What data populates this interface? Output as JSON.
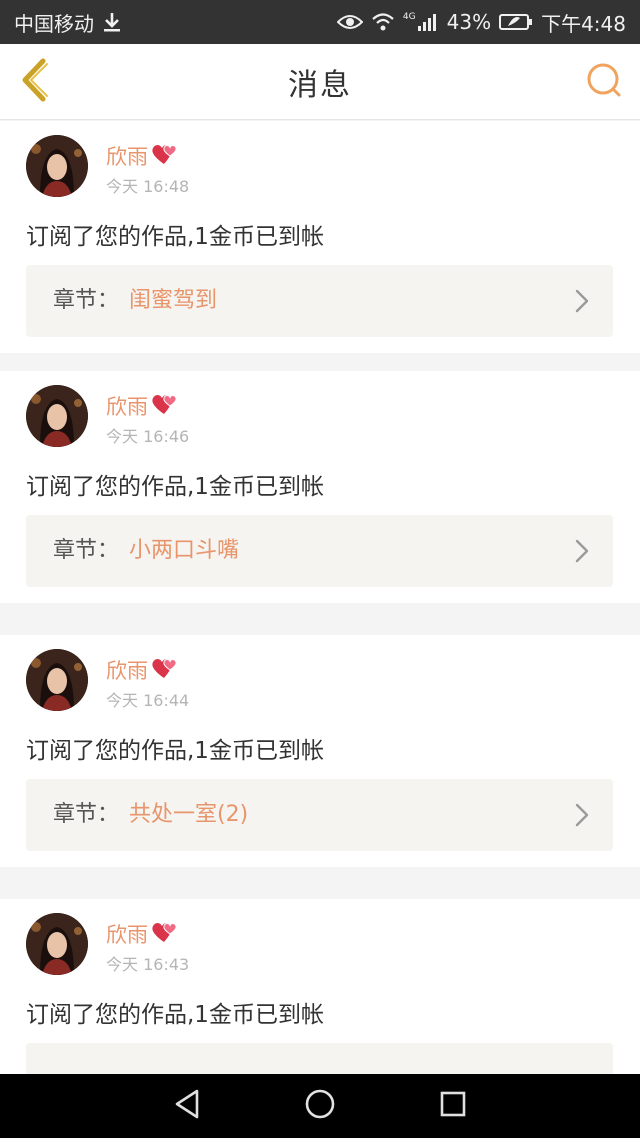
{
  "status_bar": {
    "carrier": "中国移动",
    "network": "4G",
    "battery": "43%",
    "time": "下午4:48",
    "icons": [
      "download-icon",
      "eye-icon",
      "wifi-icon",
      "signal-icon",
      "battery-icon"
    ]
  },
  "header": {
    "title": "消息",
    "back_icon": "back-chevron-icon",
    "search_icon": "search-icon"
  },
  "colors": {
    "accent": "#e8956b",
    "back_icon": "#c9a227",
    "search_icon": "#f0a35e",
    "chapter_bg": "#f5f4f0"
  },
  "messages": [
    {
      "username": "欣雨",
      "badge_icon": "hearts-icon",
      "time": "今天 16:48",
      "text": "订阅了您的作品,1金币已到帐",
      "chapter_label": "章节：",
      "chapter_name": "闺蜜驾到"
    },
    {
      "username": "欣雨",
      "badge_icon": "hearts-icon",
      "time": "今天 16:46",
      "text": "订阅了您的作品,1金币已到帐",
      "chapter_label": "章节：",
      "chapter_name": "小两口斗嘴"
    },
    {
      "username": "欣雨",
      "badge_icon": "hearts-icon",
      "time": "今天 16:44",
      "text": "订阅了您的作品,1金币已到帐",
      "chapter_label": "章节：",
      "chapter_name": "共处一室(2)"
    },
    {
      "username": "欣雨",
      "badge_icon": "hearts-icon",
      "time": "今天 16:43",
      "text": "订阅了您的作品,1金币已到帐",
      "chapter_label": "章节：",
      "chapter_name": ""
    }
  ],
  "nav_bar": {
    "icons": [
      "back-triangle-icon",
      "home-circle-icon",
      "recents-square-icon"
    ]
  }
}
